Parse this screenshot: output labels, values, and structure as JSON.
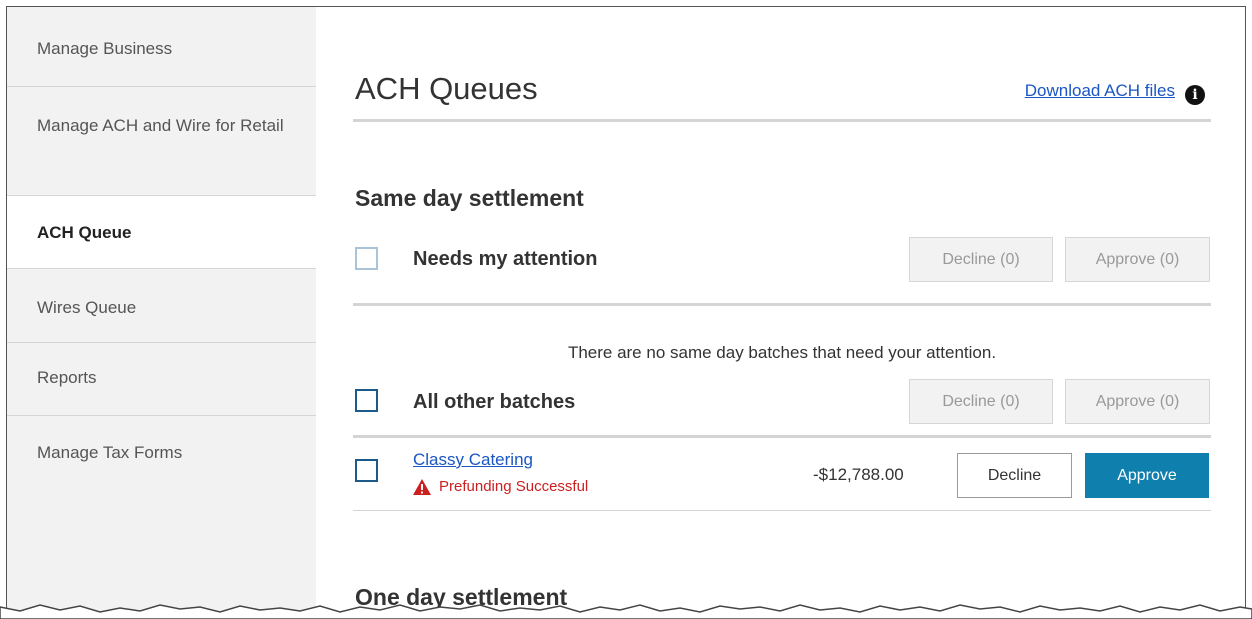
{
  "sidebar": {
    "items": [
      {
        "label": "Manage Business"
      },
      {
        "label": "Manage ACH and Wire for Retail"
      },
      {
        "label": "ACH Queue"
      },
      {
        "label": "Wires Queue"
      },
      {
        "label": "Reports"
      },
      {
        "label": "Manage Tax Forms"
      }
    ]
  },
  "main": {
    "title": "ACH Queues",
    "download_link": "Download ACH files",
    "info_icon": "info-icon",
    "same_day": {
      "title": "Same day settlement",
      "needs_attention": {
        "label": "Needs my attention",
        "decline": "Decline (0)",
        "approve": "Approve (0)",
        "empty_message": "There are no same day batches that need your attention."
      },
      "all_other": {
        "label": "All other batches",
        "decline": "Decline (0)",
        "approve": "Approve (0)"
      },
      "batches": [
        {
          "name": "Classy Catering",
          "status": "Prefunding Successful",
          "amount": "-$12,788.00",
          "decline": "Decline",
          "approve": "Approve"
        }
      ]
    },
    "one_day": {
      "title": "One day settlement"
    }
  },
  "colors": {
    "accent": "#0f7fae",
    "link": "#1a56c4",
    "warning": "#cc1f1f",
    "sidebar_bg": "#f2f2f2"
  }
}
